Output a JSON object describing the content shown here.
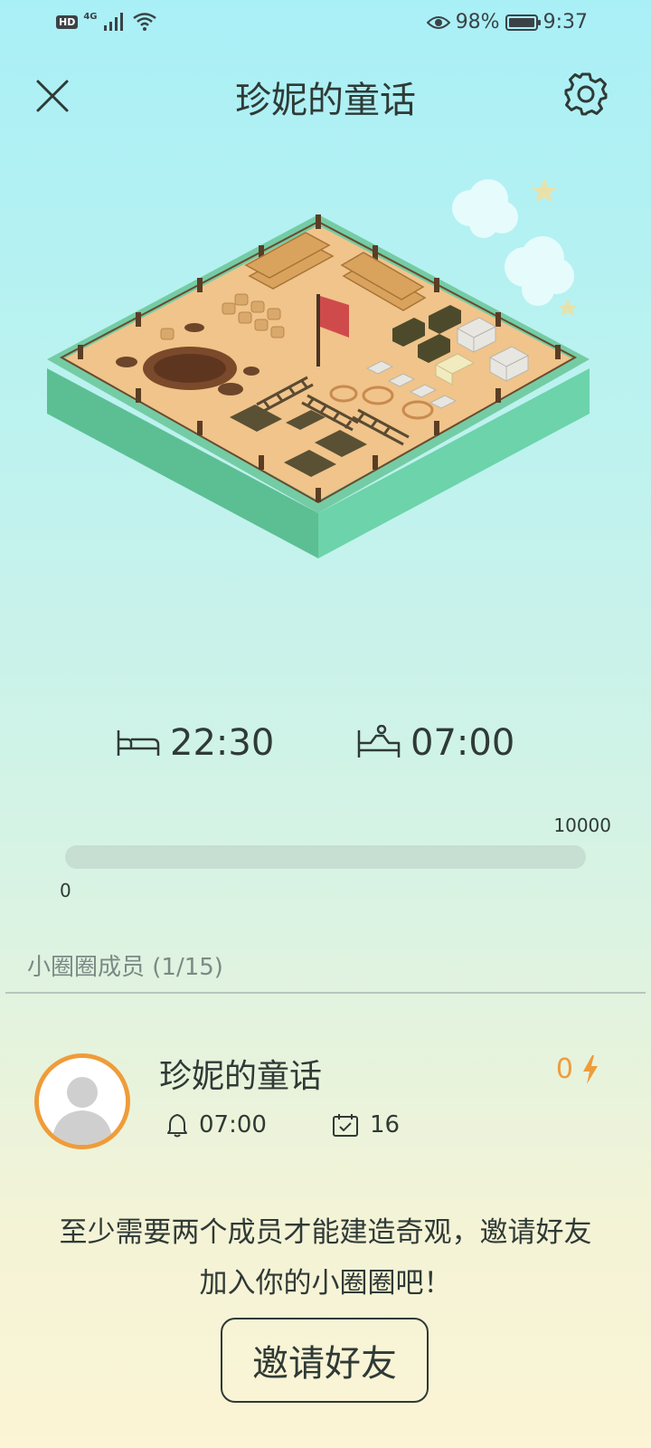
{
  "status_bar": {
    "hd": "HD",
    "network": "4G",
    "battery_percent": "98%",
    "battery_level": 0.98,
    "time": "9:37"
  },
  "header": {
    "title": "珍妮的童话",
    "close_icon": "close-icon",
    "settings_icon": "gear-icon"
  },
  "schedule": {
    "bed_time": "22:30",
    "wake_time": "07:00",
    "bed_icon": "bed-icon",
    "wake_icon": "wake-up-icon"
  },
  "progress": {
    "min_label": "0",
    "max_label": "10000",
    "value": 0
  },
  "members": {
    "header": "小圈圈成员 (1/15)",
    "list": [
      {
        "name": "珍妮的童话",
        "alarm_time": "07:00",
        "days": "16",
        "energy": "0",
        "alarm_icon": "bell-icon",
        "calendar_icon": "calendar-check-icon",
        "energy_icon": "lightning-icon"
      }
    ]
  },
  "invite": {
    "line1": "至少需要两个成员才能建造奇观，邀请好友",
    "line2": "加入你的小圈圈吧！",
    "button_label": "邀请好友"
  },
  "colors": {
    "accent": "#ef9c3a",
    "text": "#2f3a36",
    "track": "#c6dfd2"
  }
}
